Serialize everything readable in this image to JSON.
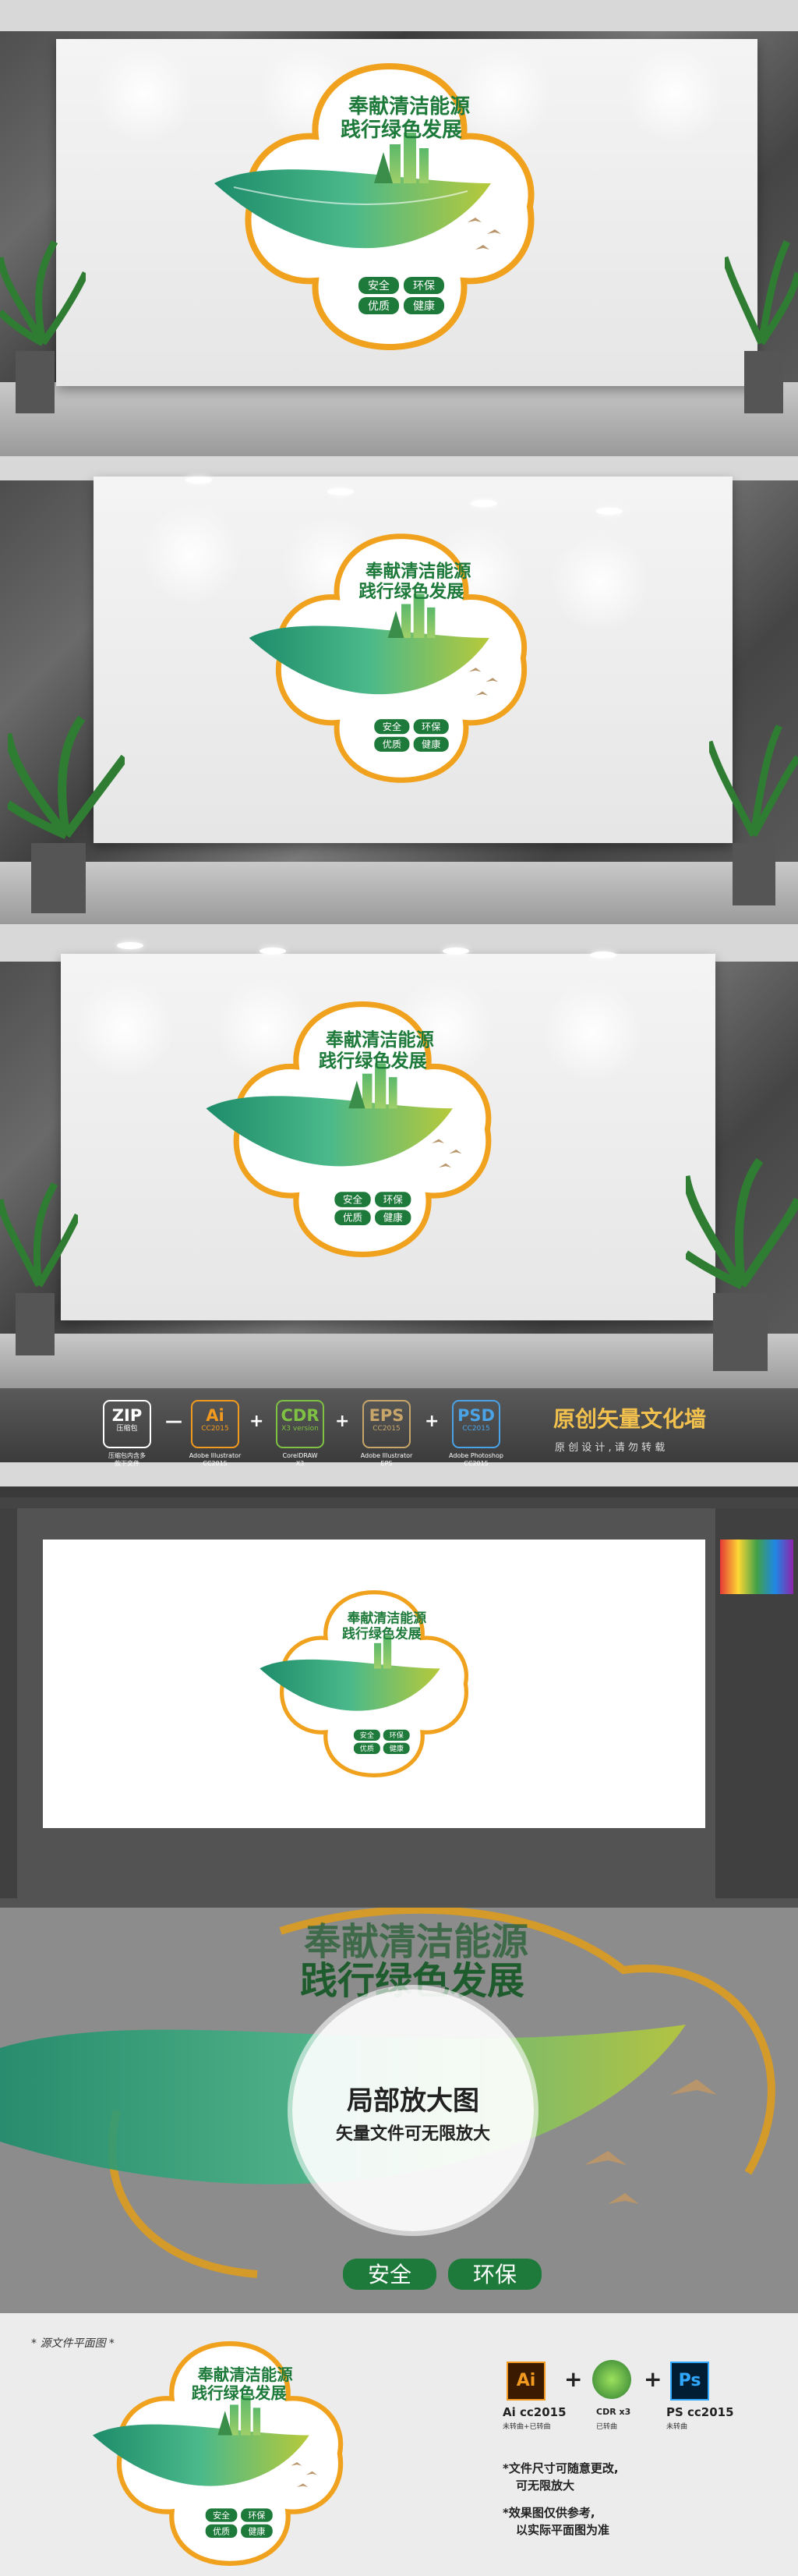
{
  "sign": {
    "title_line1": "奉献清洁能源",
    "title_line2": "践行绿色发展",
    "tag1": "安全",
    "tag2": "环保",
    "tag3": "优质",
    "tag4": "健康"
  },
  "colors": {
    "green_dark": "#1e7a3a",
    "green_leaf": "#2fa56a",
    "yellow_green": "#a8c23a",
    "orange_border": "#f0a21e",
    "bird": "#b8956a"
  },
  "formats": {
    "zip": {
      "name": "ZIP",
      "sub": "压缩包",
      "label": "压缩包内含多\n款下文件"
    },
    "ai": {
      "name": "Ai",
      "sub": "CC2015",
      "label": "Adobe Illustrator\nCC2015"
    },
    "cdr": {
      "name": "CDR",
      "sub": "X3 version",
      "label": "CorelDRAW\nX3"
    },
    "eps": {
      "name": "EPS",
      "sub": "CC2015",
      "label": "Adobe Illustrator\nEPS"
    },
    "psd": {
      "name": "PSD",
      "sub": "CC2015",
      "label": "Adobe Photoshop\nCC2015"
    },
    "minus": "—",
    "plus": "+",
    "headline": "原创矢量文化墙",
    "subline": "原 创 设 计 , 请 勿 转 载"
  },
  "zoom": {
    "title": "局部放大图",
    "subtitle": "矢量文件可无限放大"
  },
  "bottom": {
    "caption": "* 源文件平面图 *",
    "ai_label": "Ai cc2015",
    "ai_sub": "未转曲+已转曲",
    "cdr_label": "CDR x3",
    "cdr_sub": "已转曲",
    "ps_label": "PS cc2015",
    "ps_sub": "未转曲",
    "note1": "*文件尺寸可随意更改,",
    "note1b": "可无限放大",
    "note2": "*效果图仅供参考,",
    "note2b": "以实际平面图为准",
    "plus": "+"
  }
}
